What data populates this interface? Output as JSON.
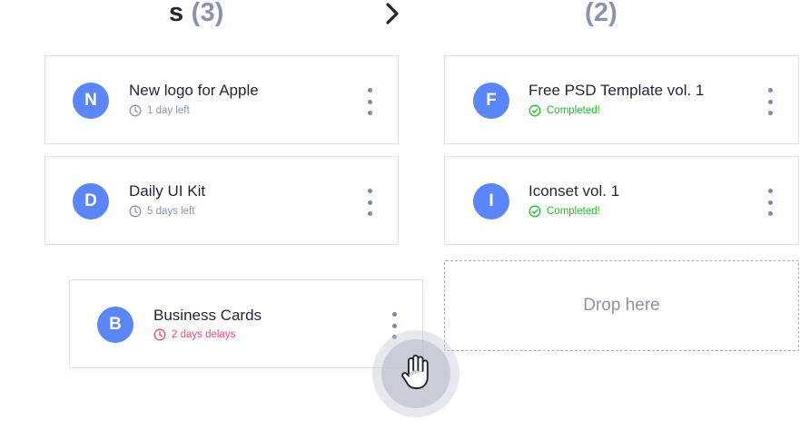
{
  "columns": {
    "left": {
      "title_fragment": "s",
      "count": "(3)"
    },
    "right": {
      "count": "(2)"
    }
  },
  "cards": [
    {
      "initial": "N",
      "title": "New logo for Apple",
      "meta": "1 day left",
      "status": "due",
      "icon": "clock-icon"
    },
    {
      "initial": "D",
      "title": "Daily UI Kit",
      "meta": "5 days left",
      "status": "due",
      "icon": "clock-icon"
    },
    {
      "initial": "B",
      "title": "Business Cards",
      "meta": "2 days delays",
      "status": "late",
      "icon": "clock-icon"
    },
    {
      "initial": "F",
      "title": "Free PSD Template vol. 1",
      "meta": "Completed!",
      "status": "done",
      "icon": "check-circle-icon"
    },
    {
      "initial": "I",
      "title": "Iconset vol. 1",
      "meta": "Completed!",
      "status": "done",
      "icon": "check-circle-icon"
    }
  ],
  "drop_zone": {
    "label": "Drop here"
  },
  "colors": {
    "avatar": "#5a86f7",
    "muted": "#8a93aa",
    "done": "#1fba2a",
    "late": "#f0477b",
    "text": "#1f2533"
  },
  "icons": [
    "chevron-right-icon",
    "clock-icon",
    "check-circle-icon",
    "more-vertical-icon",
    "grab-hand-icon"
  ]
}
